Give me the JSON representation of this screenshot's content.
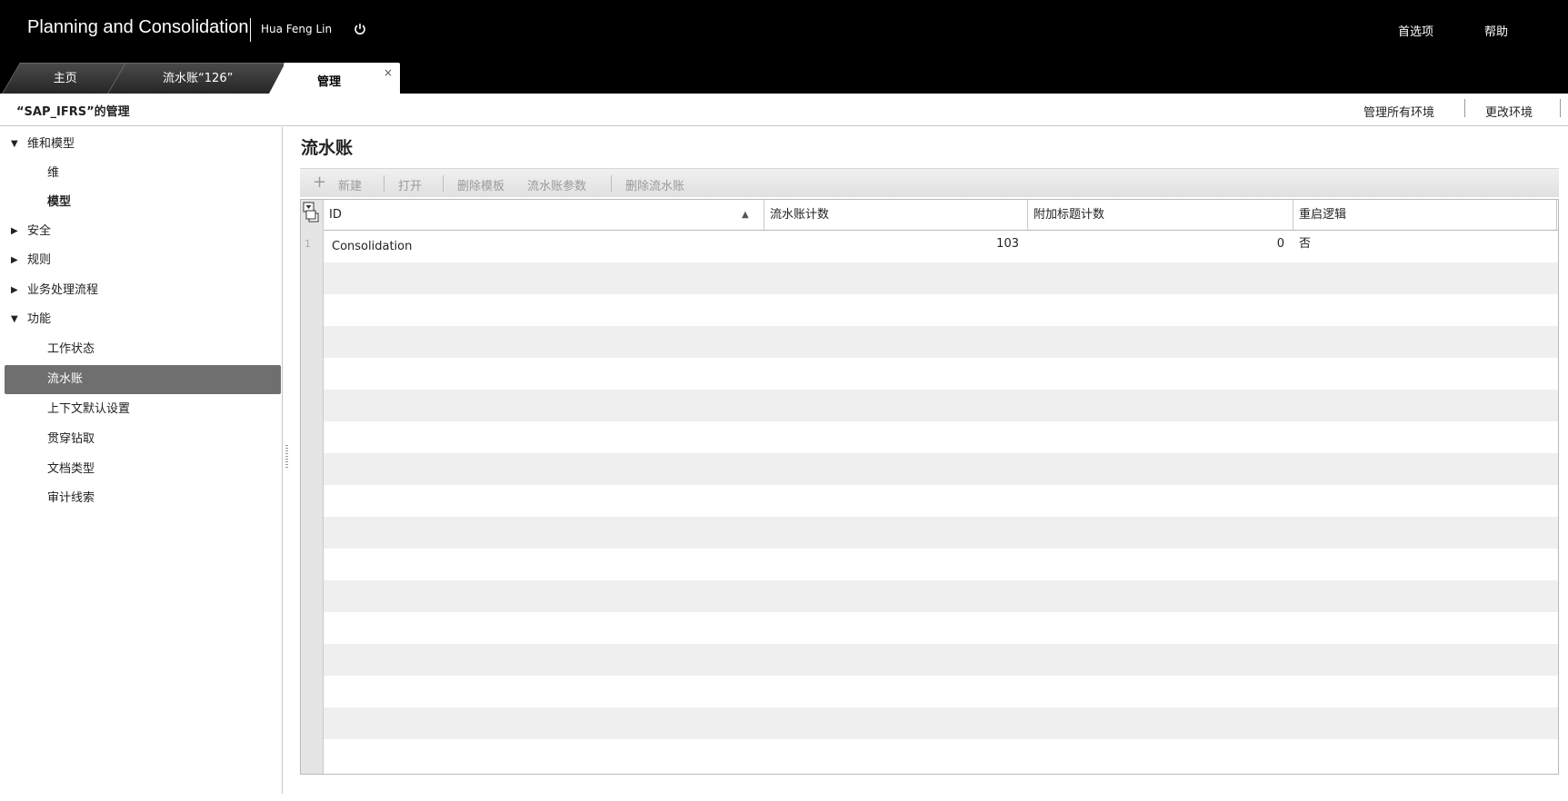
{
  "header": {
    "app_title": "Planning and Consolidation",
    "user_name": "Hua Feng Lin",
    "prefs": "首选项",
    "help": "帮助"
  },
  "tabs": [
    {
      "label": "主页"
    },
    {
      "label": "流水账“126”"
    },
    {
      "label": "管理",
      "close": "×"
    }
  ],
  "subheader": {
    "title": "“SAP_IFRS”的管理",
    "manage_all": "管理所有环境",
    "change_env": "更改环境"
  },
  "sidebar": {
    "items": [
      {
        "label": "维和模型",
        "expand": "▼"
      },
      {
        "label": "维"
      },
      {
        "label": "模型"
      },
      {
        "label": "安全",
        "expand": "▶"
      },
      {
        "label": "规则",
        "expand": "▶"
      },
      {
        "label": "业务处理流程",
        "expand": "▶"
      },
      {
        "label": "功能",
        "expand": "▼"
      },
      {
        "label": "工作状态"
      },
      {
        "label": "流水账",
        "selected": true
      },
      {
        "label": "上下文默认设置"
      },
      {
        "label": "贯穿钻取"
      },
      {
        "label": "文档类型"
      },
      {
        "label": "审计线索"
      }
    ]
  },
  "main": {
    "title": "流水账",
    "toolbar": {
      "new": "新建",
      "open": "打开",
      "delete_template": "删除模板",
      "journal_params": "流水账参数",
      "delete_journal": "删除流水账"
    },
    "grid": {
      "columns": [
        "ID",
        "流水账计数",
        "附加标题计数",
        "重启逻辑"
      ],
      "rows": [
        {
          "num": "1",
          "id": "Consolidation",
          "count": "103",
          "header_count": "0",
          "reopen": "否"
        }
      ]
    }
  }
}
